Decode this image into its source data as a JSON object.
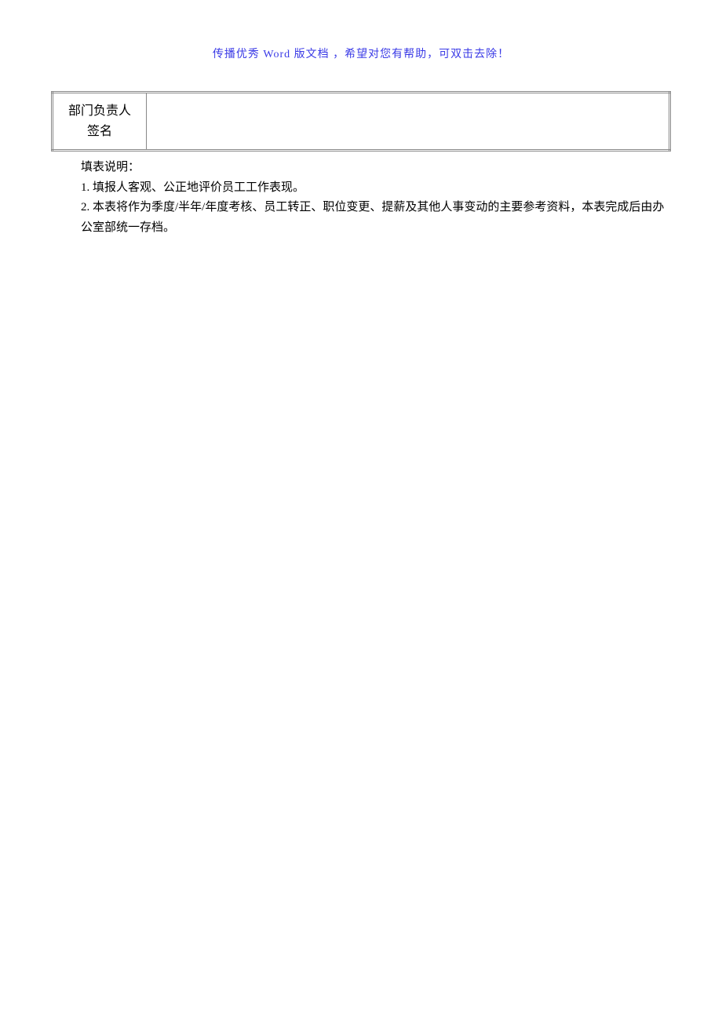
{
  "header": {
    "note": "传播优秀 Word 版文档 ，希望对您有帮助，可双击去除！"
  },
  "table": {
    "label_line1": "部门负责人",
    "label_line2": "签名"
  },
  "notes": {
    "heading": "填表说明：",
    "item1": "1. 填报人客观、公正地评价员工工作表现。",
    "item2": "2. 本表将作为季度/半年/年度考核、员工转正、职位变更、提薪及其他人事变动的主要参考资料，本表完成后由办公室部统一存档。"
  }
}
